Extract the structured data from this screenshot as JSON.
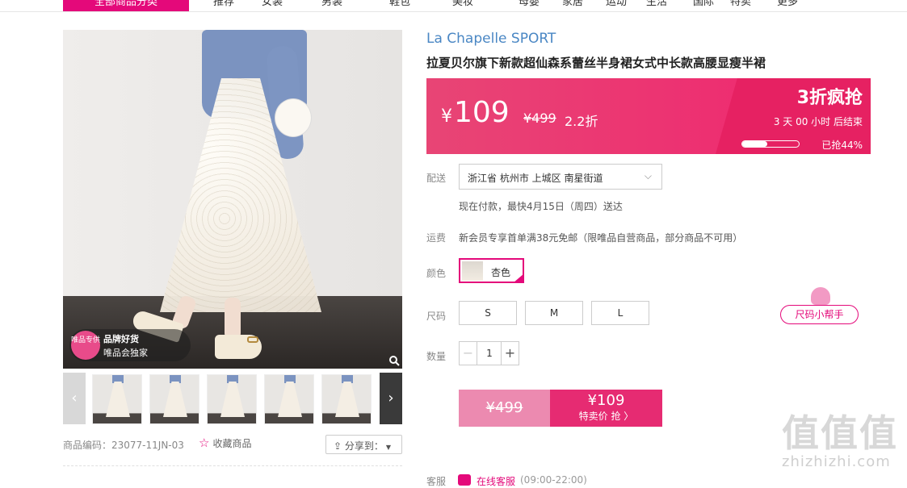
{
  "nav": {
    "category_label": "全部商品分类",
    "items": [
      "推荐",
      "女装",
      "男装",
      "鞋包",
      "美妆",
      "母婴",
      "家居",
      "运动",
      "生活",
      "国际",
      "特卖",
      "更多"
    ]
  },
  "gallery": {
    "badge_circle": "唯品专供",
    "badge_line1": "品牌好货",
    "badge_line2": "唯品会独家",
    "prev_arrow": "‹",
    "next_arrow": "›"
  },
  "product": {
    "code_label": "商品编码：23077-11JN-03",
    "favorite_label": "收藏商品",
    "share_label": "分享到：",
    "brand": "La Chapelle SPORT",
    "title": "拉夏贝尔旗下新款超仙森系蕾丝半身裙女式中长款高腰显瘦半裙"
  },
  "price": {
    "currency": "¥",
    "sale": "109",
    "original": "¥499",
    "discount": "2.2折",
    "flash_title": "3折疯抢",
    "countdown": "3  天 00 小时 后结束",
    "grabbed_label": "已抢44%",
    "grabbed_fraction": 0.44
  },
  "delivery": {
    "label": "配送",
    "address": "浙江省 杭州市 上城区 南星街道",
    "eta": "现在付款，最快4月15日（周四）送达"
  },
  "shipping": {
    "label": "运费",
    "text": "新会员专享首单满38元免邮（限唯品自营商品，部分商品不可用）"
  },
  "color": {
    "label": "颜色",
    "selected": "杏色"
  },
  "size": {
    "label": "尺码",
    "options": [
      "S",
      "M",
      "L"
    ],
    "helper": "尺码小帮手"
  },
  "quantity": {
    "label": "数量",
    "value": "1",
    "minus": "−",
    "plus": "+"
  },
  "buy": {
    "original": "¥499",
    "price": "¥109",
    "cta": "特卖价 抢 〉"
  },
  "service": {
    "label": "客服",
    "online": "在线客服",
    "hours": "(09:00-22:00)"
  },
  "watermark": {
    "text": "值值值",
    "url": "zhizhizhi.com"
  }
}
